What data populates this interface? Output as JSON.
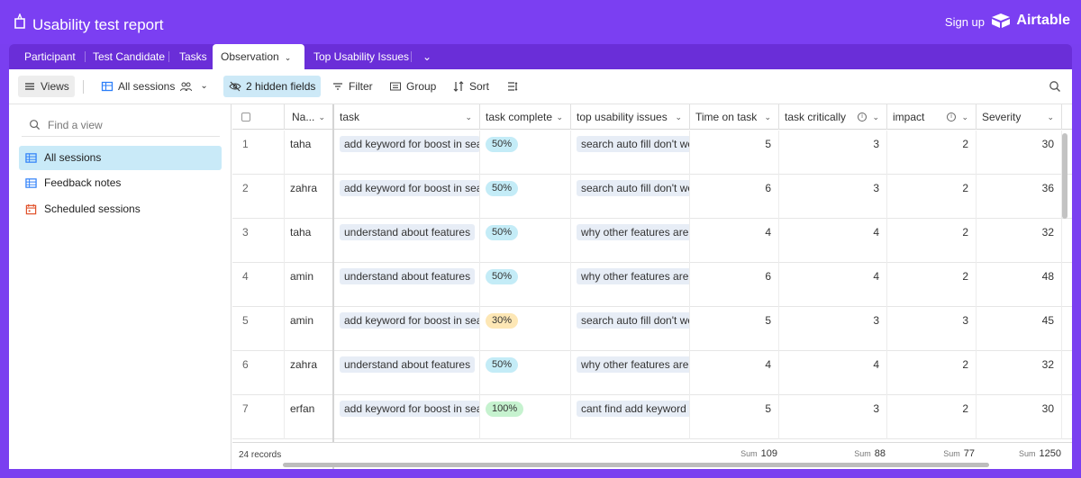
{
  "header": {
    "app_title": "Usability test report",
    "signup_label": "Sign up",
    "brand_name": "Airtable"
  },
  "tabs": [
    {
      "label": "Participant"
    },
    {
      "label": "Test Candidate"
    },
    {
      "label": "Tasks"
    },
    {
      "label": "Observation"
    },
    {
      "label": "Top Usability Issues"
    }
  ],
  "toolbar": {
    "views_label": "Views",
    "current_view": "All sessions",
    "hidden_fields_label": "2 hidden fields",
    "filter_label": "Filter",
    "group_label": "Group",
    "sort_label": "Sort"
  },
  "sidebar": {
    "search_placeholder": "Find a view",
    "views": [
      {
        "label": "All sessions",
        "icon": "grid-view-icon"
      },
      {
        "label": "Feedback notes",
        "icon": "grid-view-icon"
      },
      {
        "label": "Scheduled sessions",
        "icon": "calendar-view-icon"
      }
    ]
  },
  "table": {
    "columns": [
      "Na...",
      "task",
      "task complete",
      "top usability issues",
      "Time on task",
      "task critically",
      "impact",
      "Severity"
    ],
    "rows": [
      {
        "num": "1",
        "name": "taha",
        "task": "add keyword for boost in search",
        "complete": "50%",
        "issue": "search auto fill don't work",
        "time": "5",
        "critically": "3",
        "impact": "2",
        "severity": "30"
      },
      {
        "num": "2",
        "name": "zahra",
        "task": "add keyword for boost in search",
        "complete": "50%",
        "issue": "search auto fill don't work",
        "time": "6",
        "critically": "3",
        "impact": "2",
        "severity": "36"
      },
      {
        "num": "3",
        "name": "taha",
        "task": "understand about features",
        "complete": "50%",
        "issue": "why other features are in",
        "time": "4",
        "critically": "4",
        "impact": "2",
        "severity": "32"
      },
      {
        "num": "4",
        "name": "amin",
        "task": "understand about features",
        "complete": "50%",
        "issue": "why other features are in",
        "time": "6",
        "critically": "4",
        "impact": "2",
        "severity": "48"
      },
      {
        "num": "5",
        "name": "amin",
        "task": "add keyword for boost in search",
        "complete": "30%",
        "issue": "search auto fill don't work",
        "time": "5",
        "critically": "3",
        "impact": "3",
        "severity": "45"
      },
      {
        "num": "6",
        "name": "zahra",
        "task": "understand about features",
        "complete": "50%",
        "issue": "why other features are in",
        "time": "4",
        "critically": "4",
        "impact": "2",
        "severity": "32"
      },
      {
        "num": "7",
        "name": "erfan",
        "task": "add keyword for boost in search",
        "complete": "100%",
        "issue": "cant find add keyword",
        "time": "5",
        "critically": "3",
        "impact": "2",
        "severity": "30"
      }
    ],
    "footer": {
      "records": "24 records",
      "sum_label": "Sum",
      "sum_time": "109",
      "sum_critically": "88",
      "sum_impact": "77",
      "sum_severity": "1250"
    }
  },
  "colors": {
    "brand_purple": "#7b3ff2",
    "pill_50": "#c4ecf7",
    "pill_30": "#fde7b5",
    "pill_100": "#c6f2cf"
  }
}
